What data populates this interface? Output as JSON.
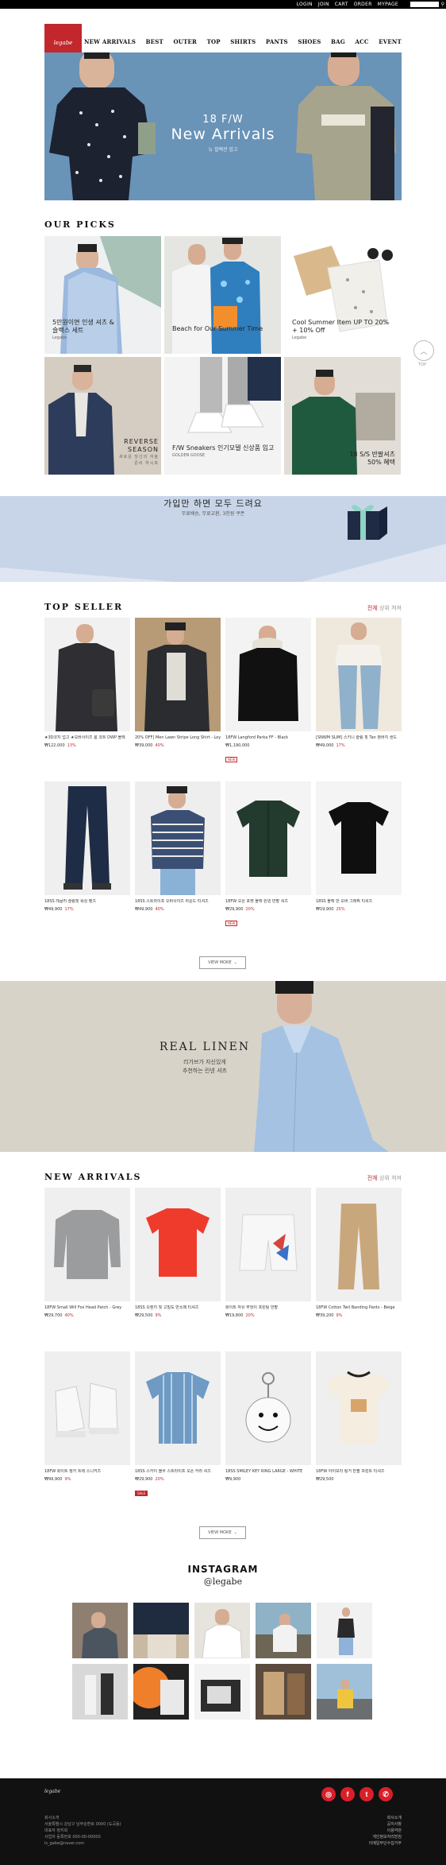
{
  "top_links": [
    "LOGIN",
    "JOIN",
    "CART",
    "ORDER",
    "MYPAGE"
  ],
  "brand": {
    "logo_text": "legabe"
  },
  "nav": [
    "NEW ARRIVALS",
    "BEST",
    "OUTER",
    "TOP",
    "SHIRTS",
    "PANTS",
    "SHOES",
    "BAG",
    "ACC",
    "EVENT"
  ],
  "hero": {
    "line1": "18 F/W",
    "line2": "New Arrivals",
    "line3": "뉴 컬렉션 업고"
  },
  "picks": {
    "title": "OUR PICKS",
    "items": [
      {
        "caption": "5만원이면 인생 셔츠 & 슬랙스 세트",
        "sub": "Legabe"
      },
      {
        "caption": "Beach for Our Summer Time",
        "sub": ""
      },
      {
        "caption": "Cool Summer Item UP TO 20% + 10% Off",
        "sub": "Legabe"
      },
      {
        "caption": "REVERSE SEASON",
        "sub": "새로운 당신의 겨울 준비 하시죠"
      },
      {
        "caption": "F/W Sneakers 인기모델 신상품 입고",
        "sub": "GOLDEN GOOSE"
      },
      {
        "caption": "18 S/S 반팔셔츠 50% 혜택",
        "sub": ""
      }
    ],
    "top_button": "TOP"
  },
  "join_banner": {
    "title": "가입만 하면 모두 드려요",
    "sub": "무료배송, 무료교환, 3천원 쿠폰"
  },
  "top_seller": {
    "title": "TOP SELLER",
    "link_all": "전체",
    "link_more": "상위 쳐져",
    "items": [
      {
        "name": "★3D코지 업고 ★오버사이즈 롱 코트 DWP 블랙",
        "price": "₩122,000",
        "rate": "13%",
        "tag": ""
      },
      {
        "name": "20% OFF] Men Lawn Stripe Long Shirt - Loyal Blue",
        "price": "₩39,000",
        "rate": "40%",
        "tag": ""
      },
      {
        "name": "18FW Langford Parka FF - Black",
        "price": "₩1,190,000",
        "rate": "",
        "tag": "NEW"
      },
      {
        "name": "[SNWM SLIM] 스키니 슬림 핏 Tan 청바지 샌드",
        "price": "₩49,000",
        "rate": "17%",
        "tag": ""
      },
      {
        "name": "18SS 레귤러 슬림핏 워싱 팬츠",
        "price": "₩49,900",
        "rate": "17%",
        "tag": ""
      },
      {
        "name": "18SS 스트라이프 오버사이즈 라운드 티셔츠",
        "price": "₩49,900",
        "rate": "40%",
        "tag": ""
      },
      {
        "name": "18FW 오픈 포켓 블랙 린넨 반팔 셔츠",
        "price": "₩29,900",
        "rate": "20%",
        "tag": "NEW"
      },
      {
        "name": "18SS 블랙 반 오버 그래픽 티셔츠",
        "price": "₩19,900",
        "rate": "25%",
        "tag": ""
      }
    ],
    "view_more": "VIEW MORE"
  },
  "linen": {
    "title": "REAL LINEN",
    "line1": "리가브가 자신있게",
    "line2": "추천하는 린넨 셔츠"
  },
  "new_arrivals": {
    "title": "NEW ARRIVALS",
    "link_all": "전체",
    "link_more": "상위 쳐져",
    "items": [
      {
        "name": "18FW Small Will Fox Head Patch - Grey",
        "price": "₩29,700",
        "rate": "40%",
        "tag": ""
      },
      {
        "name": "18SS 오렌지 핏 고밀도 반소매 티셔츠",
        "price": "₩29,500",
        "rate": "9%",
        "tag": ""
      },
      {
        "name": "화이트 자유 부엉이 프린팅 반팔",
        "price": "₩19,800",
        "rate": "20%",
        "tag": ""
      },
      {
        "name": "18FW Cotton Twil Banding Pants - Beige",
        "price": "₩39,200",
        "rate": "9%",
        "tag": ""
      },
      {
        "name": "18FW 화이트 청키 트레 스니커즈",
        "price": "₩99,900",
        "rate": "9%",
        "tag": ""
      },
      {
        "name": "18SS 스카이 블루 스트라이프 오픈 카라 셔츠",
        "price": "₩29,900",
        "rate": "20%",
        "tag": "SALE"
      },
      {
        "name": "18SS SMILEY KEY RING LARGE - WHITE",
        "price": "₩9,900",
        "rate": "",
        "tag": ""
      },
      {
        "name": "18FW 아이보리 링거 반팔 프린트 티셔츠",
        "price": "₩29,500",
        "rate": "",
        "tag": ""
      }
    ],
    "view_more": "VIEW MORE"
  },
  "instagram": {
    "title": "INSTAGRAM",
    "handle": "@legabe"
  },
  "footer": {
    "logo": "legabe",
    "info": [
      "회사소개",
      "서울특별시 강남구 남부순환로 0000 (도곡동)",
      "대표자 정지회",
      "사업자 등록번호 000-00-00000",
      "ls_gabe@naver.com"
    ],
    "links": [
      "회사소개",
      "공지사항",
      "이용약관",
      "개인정보처리방침",
      "이메일무단수집거부"
    ],
    "social": [
      "instagram-icon",
      "facebook-icon",
      "twitter-icon",
      "whatsapp-icon"
    ]
  },
  "colors": {
    "accent": "#c1272d",
    "hero_bg": "#6a93b8",
    "banner_bg": "#c8d5e8",
    "linen_bg": "#d8d3c9",
    "footer_bg": "#111111"
  }
}
